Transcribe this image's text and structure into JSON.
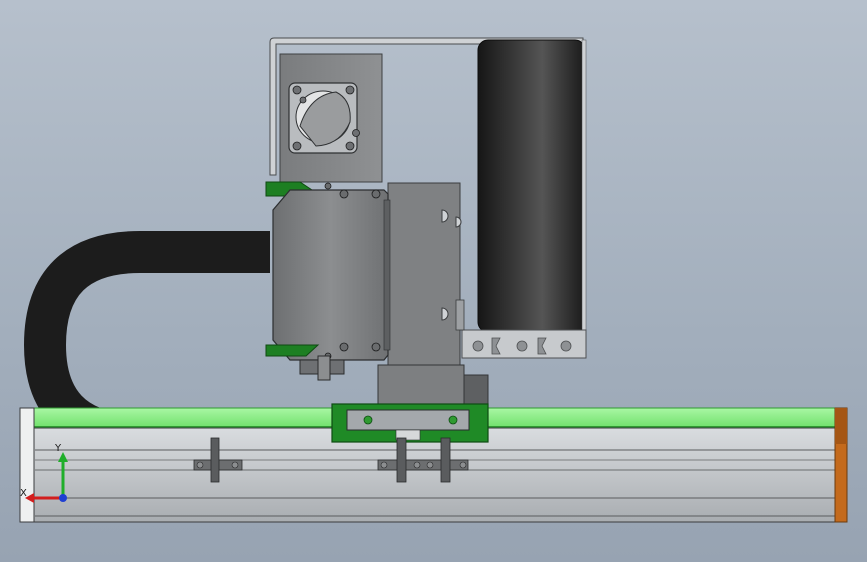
{
  "viewport": {
    "background_top": "#b6c0cc",
    "background_bottom": "#97a3b2"
  },
  "colors": {
    "rail_green": "#7ff07a",
    "rail_dark_green": "#2f9a31",
    "carriage_green": "#1f8a26",
    "bracket_green": "#1d7f22",
    "motor_gray": "#7e8082",
    "plate_gray": "#8b8d8f",
    "profile_gray": "#a4a8ac",
    "cable_black": "#1c1c1c",
    "end_cap_orange": "#c46a1c"
  },
  "triad": {
    "x_label": "X",
    "y_label": "Y",
    "x_color": "#d21e1e",
    "y_color": "#1fae2a",
    "z_color": "#1f3fd2"
  },
  "icons": {
    "triad": "xyz-axis-triad-icon"
  }
}
